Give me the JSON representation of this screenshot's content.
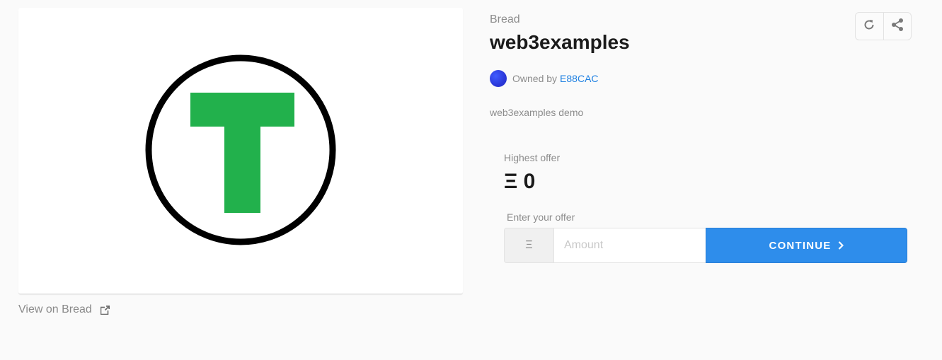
{
  "collection": "Bread",
  "title": "web3examples",
  "owner": {
    "prefix": "Owned by",
    "name": "E88CAC"
  },
  "description": "web3examples demo",
  "offer": {
    "highest_label": "Highest offer",
    "highest_value": "Ξ 0",
    "enter_label": "Enter your offer",
    "currency_symbol": "Ξ",
    "amount_placeholder": "Amount",
    "continue_label": "CONTINUE"
  },
  "view_link": "View on Bread",
  "icons": {
    "refresh": "refresh-icon",
    "share": "share-icon",
    "external": "external-link-icon",
    "chevron": "chevron-right-icon"
  },
  "colors": {
    "accent": "#2e8deb",
    "link": "#2081e2",
    "logo_green": "#22b14c",
    "logo_ring": "#000000"
  }
}
